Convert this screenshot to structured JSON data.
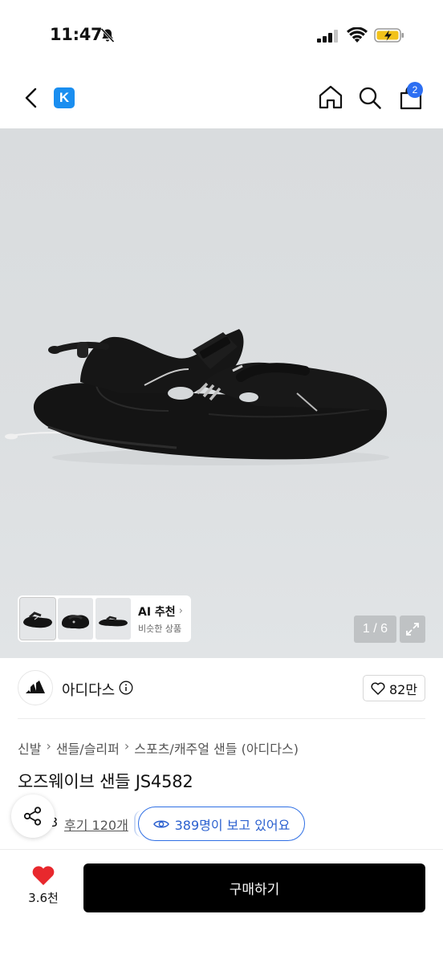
{
  "status_bar": {
    "time": "11:47"
  },
  "nav": {
    "app_logo_letter": "K",
    "cart_badge": "2"
  },
  "gallery": {
    "ai_title": "AI 추천",
    "ai_subtitle": "비슷한 상품",
    "page_counter": "1 / 6"
  },
  "brand": {
    "name": "아디다스",
    "likes": "82만"
  },
  "product": {
    "breadcrumb": [
      "신발",
      "샌들/슬리퍼",
      "스포츠/캐주얼 샌들 (아디다스)"
    ],
    "title": "오즈웨이브 샌들 JS4582",
    "rating_partial": "3",
    "review_link": "후기 120개",
    "viewers": "389명이 보고 있어요"
  },
  "bottom_bar": {
    "wish_count": "3.6천",
    "buy_label": "구매하기"
  },
  "colors": {
    "accent_blue": "#2f6fe4",
    "heart_red": "#e8282d",
    "buy_button": "#000000"
  }
}
